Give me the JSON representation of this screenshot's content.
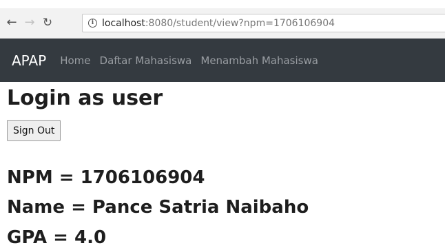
{
  "browser": {
    "url_host": "localhost",
    "url_rest": ":8080/student/view?npm=1706106904"
  },
  "navbar": {
    "brand": "APAP",
    "links": [
      "Home",
      "Daftar Mahasiswa",
      "Menambah Mahasiswa"
    ]
  },
  "page": {
    "title": "Login as user",
    "signout_label": "Sign Out"
  },
  "student": {
    "npm_line": "NPM = 1706106904",
    "name_line": "Name = Pance Satria Naibaho",
    "gpa_line": "GPA = 4.0"
  }
}
